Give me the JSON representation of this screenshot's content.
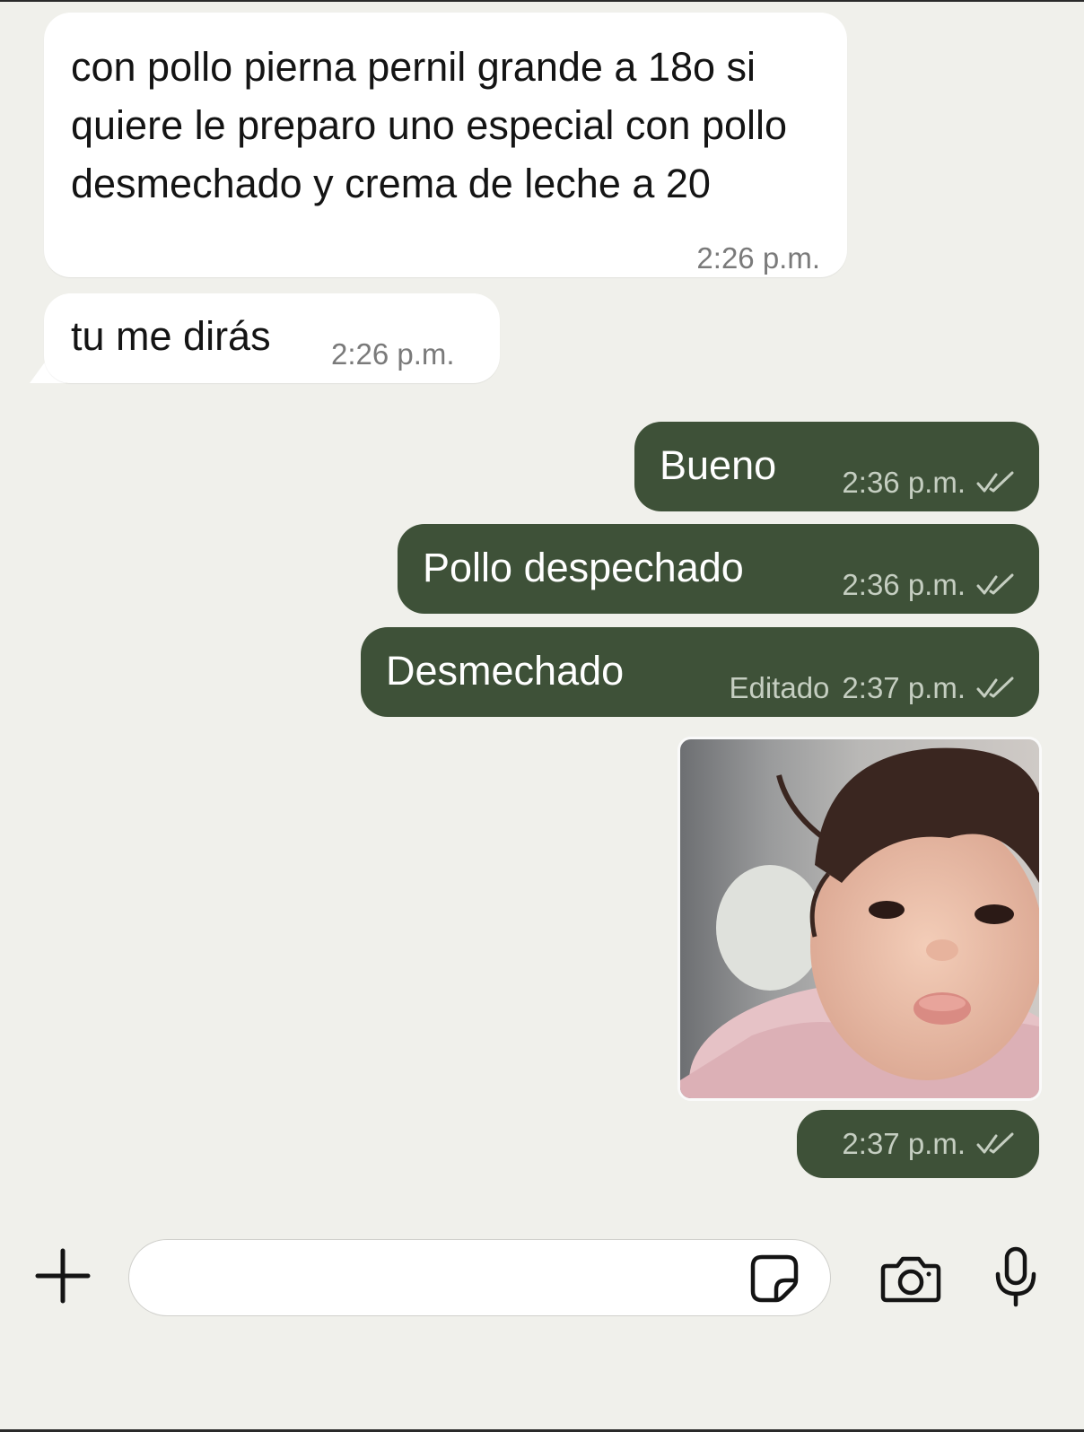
{
  "messages": [
    {
      "direction": "incoming",
      "text": "con pollo pierna pernil grande a 18o si quiere le preparo uno especial con pollo desmechado y crema de leche a 20",
      "time": "2:26 p.m."
    },
    {
      "direction": "incoming",
      "text": "tu me dirás",
      "time": "2:26 p.m."
    },
    {
      "direction": "outgoing",
      "text": "Bueno",
      "time": "2:36 p.m.",
      "status": "read"
    },
    {
      "direction": "outgoing",
      "text": "Pollo despechado",
      "time": "2:36 p.m.",
      "status": "read"
    },
    {
      "direction": "outgoing",
      "text": "Desmechado",
      "edited_label": "Editado",
      "time": "2:37 p.m.",
      "status": "read"
    },
    {
      "direction": "outgoing",
      "type": "image",
      "image_desc": "baby-pout-photo",
      "time": "2:37 p.m.",
      "status": "read"
    }
  ],
  "composer": {
    "placeholder": "",
    "icons": [
      "plus-icon",
      "sticker-icon",
      "camera-icon",
      "microphone-icon"
    ]
  },
  "colors": {
    "background": "#f0f0eb",
    "incoming_bubble": "#ffffff",
    "outgoing_bubble": "#3e5138"
  }
}
